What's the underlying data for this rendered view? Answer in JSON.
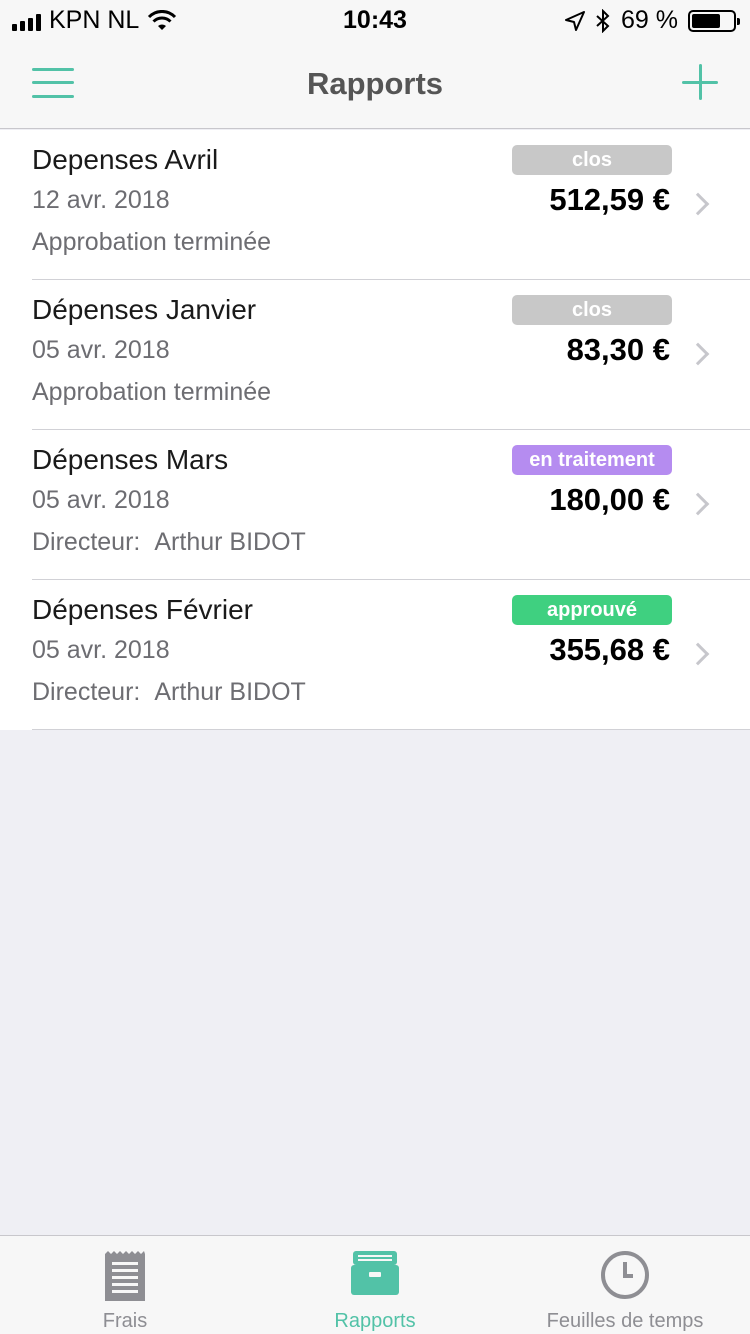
{
  "status_bar": {
    "carrier": "KPN NL",
    "time": "10:43",
    "battery_percent": "69 %",
    "battery_level": 0.69
  },
  "nav": {
    "title": "Rapports"
  },
  "reports": [
    {
      "title": "Depenses Avril",
      "date": "12 avr. 2018",
      "subtitle": "Approbation terminée",
      "status": "clos",
      "status_color": "#c8c8c8",
      "amount": "512,59 €"
    },
    {
      "title": "Dépenses Janvier",
      "date": "05 avr. 2018",
      "subtitle": "Approbation terminée",
      "status": "clos",
      "status_color": "#c8c8c8",
      "amount": "83,30 €"
    },
    {
      "title": "Dépenses Mars",
      "date": "05 avr. 2018",
      "subtitle_label": "Directeur:",
      "subtitle_value": "Arthur BIDOT",
      "status": "en traitement",
      "status_color": "#b58cf0",
      "amount": "180,00 €"
    },
    {
      "title": "Dépenses Février",
      "date": "05 avr. 2018",
      "subtitle_label": "Directeur:",
      "subtitle_value": "Arthur BIDOT",
      "status": "approuvé",
      "status_color": "#3fd080",
      "amount": "355,68 €"
    }
  ],
  "tab_bar": {
    "tabs": [
      {
        "label": "Frais",
        "icon": "receipt-icon",
        "active": false
      },
      {
        "label": "Rapports",
        "icon": "archive-box-icon",
        "active": true
      },
      {
        "label": "Feuilles de temps",
        "icon": "clock-icon",
        "active": false
      }
    ]
  },
  "colors": {
    "accent": "#52c2a7",
    "background": "#efeff4"
  }
}
